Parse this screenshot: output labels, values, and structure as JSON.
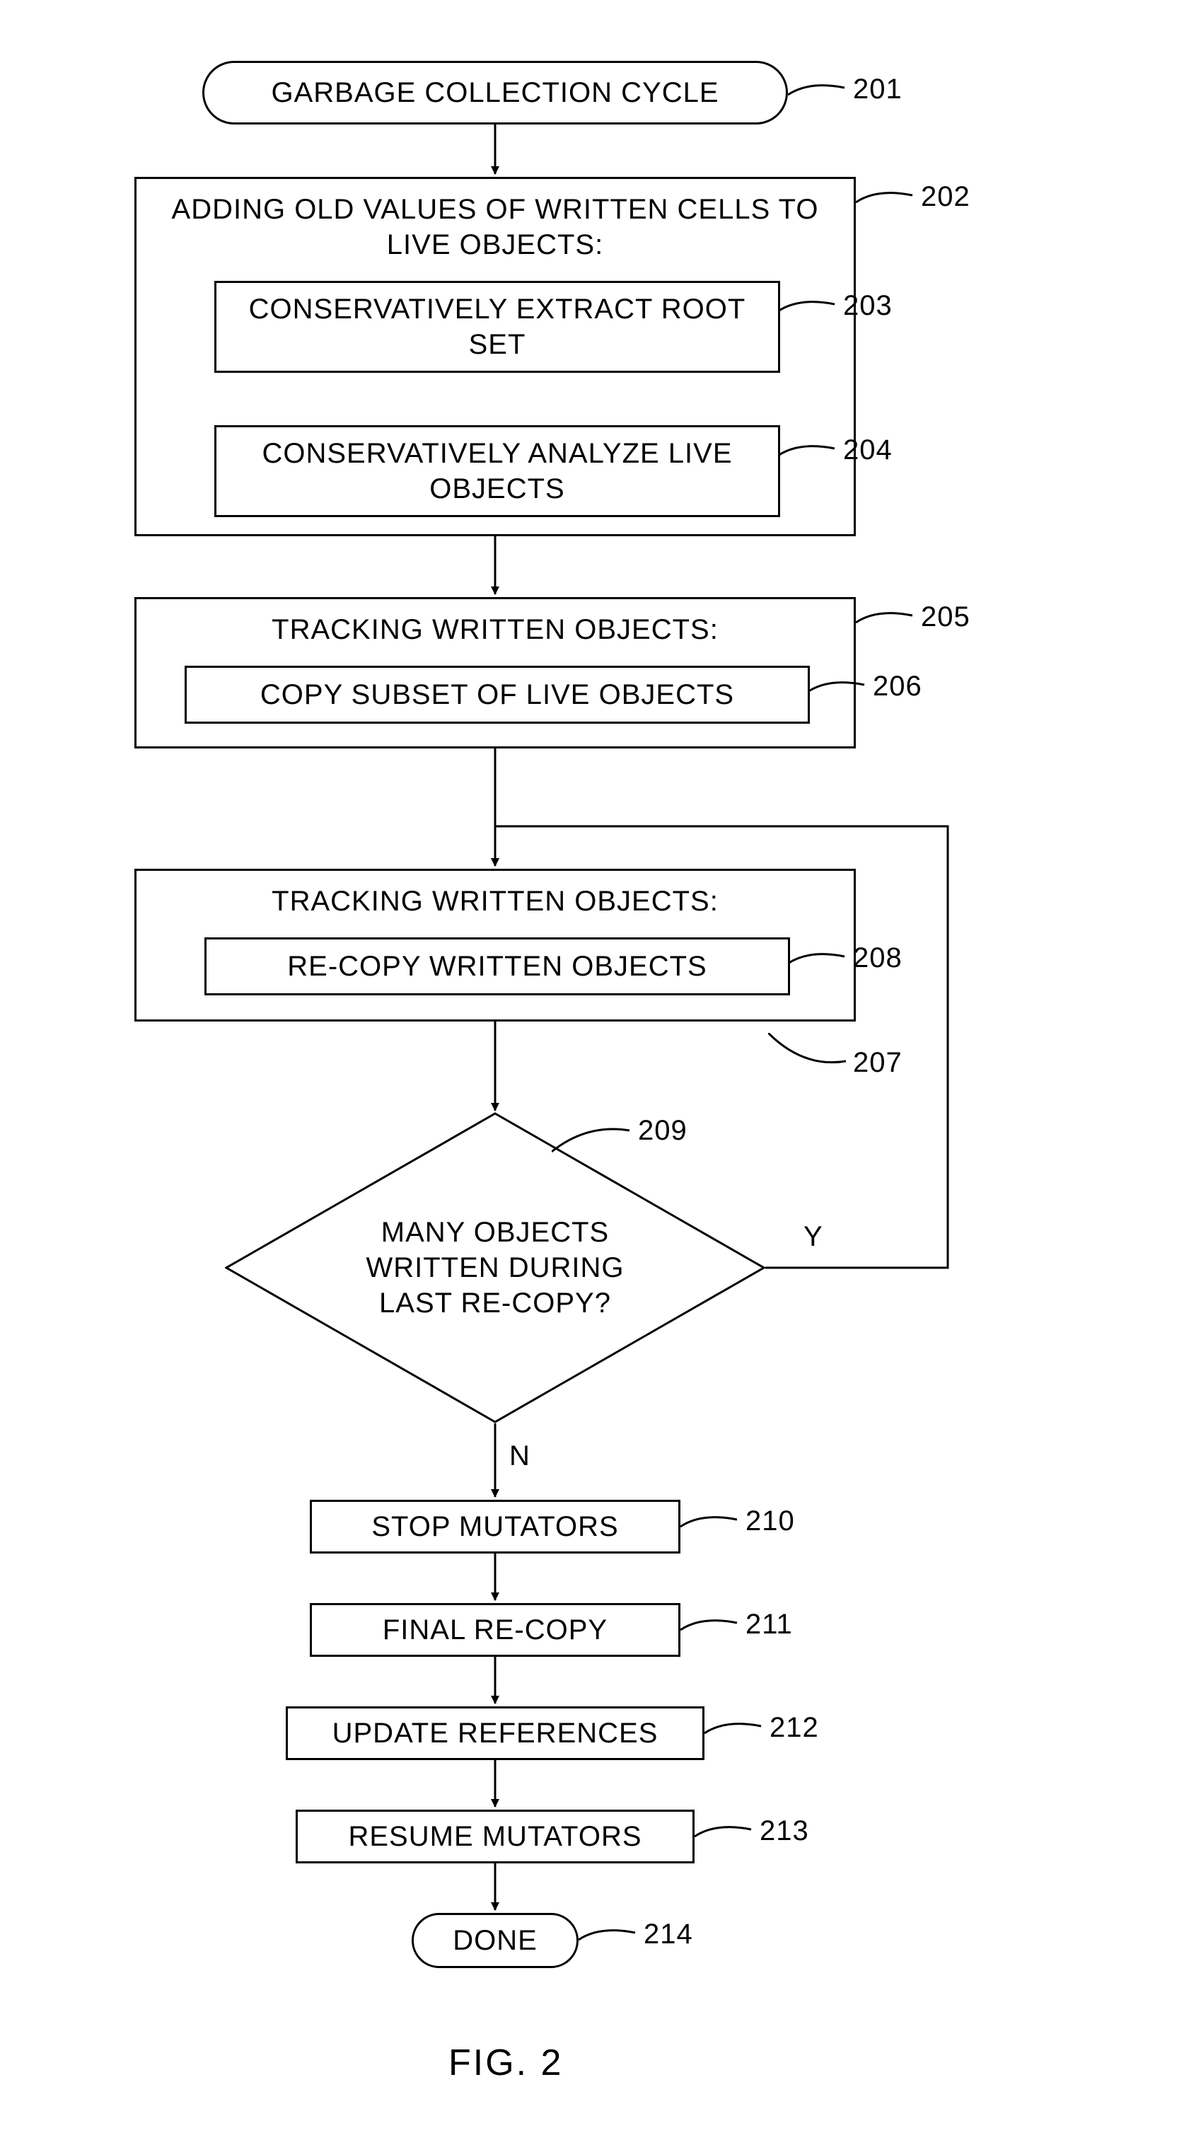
{
  "nodes": {
    "n201": "GARBAGE COLLECTION CYCLE",
    "n202_title": "ADDING OLD VALUES OF WRITTEN CELLS TO LIVE OBJECTS:",
    "n203": "CONSERVATIVELY EXTRACT ROOT SET",
    "n204": "CONSERVATIVELY ANALYZE LIVE OBJECTS",
    "n205_title": "TRACKING WRITTEN OBJECTS:",
    "n206": "COPY SUBSET OF LIVE OBJECTS",
    "n207_title": "TRACKING WRITTEN OBJECTS:",
    "n208": "RE-COPY WRITTEN OBJECTS",
    "n209": "MANY OBJECTS WRITTEN DURING LAST RE-COPY?",
    "n210": "STOP MUTATORS",
    "n211": "FINAL RE-COPY",
    "n212": "UPDATE REFERENCES",
    "n213": "RESUME MUTATORS",
    "n214": "DONE"
  },
  "labels": {
    "l201": "201",
    "l202": "202",
    "l203": "203",
    "l204": "204",
    "l205": "205",
    "l206": "206",
    "l207": "207",
    "l208": "208",
    "l209": "209",
    "l210": "210",
    "l211": "211",
    "l212": "212",
    "l213": "213",
    "l214": "214",
    "yes": "Y",
    "no": "N"
  },
  "caption": "FIG. 2"
}
